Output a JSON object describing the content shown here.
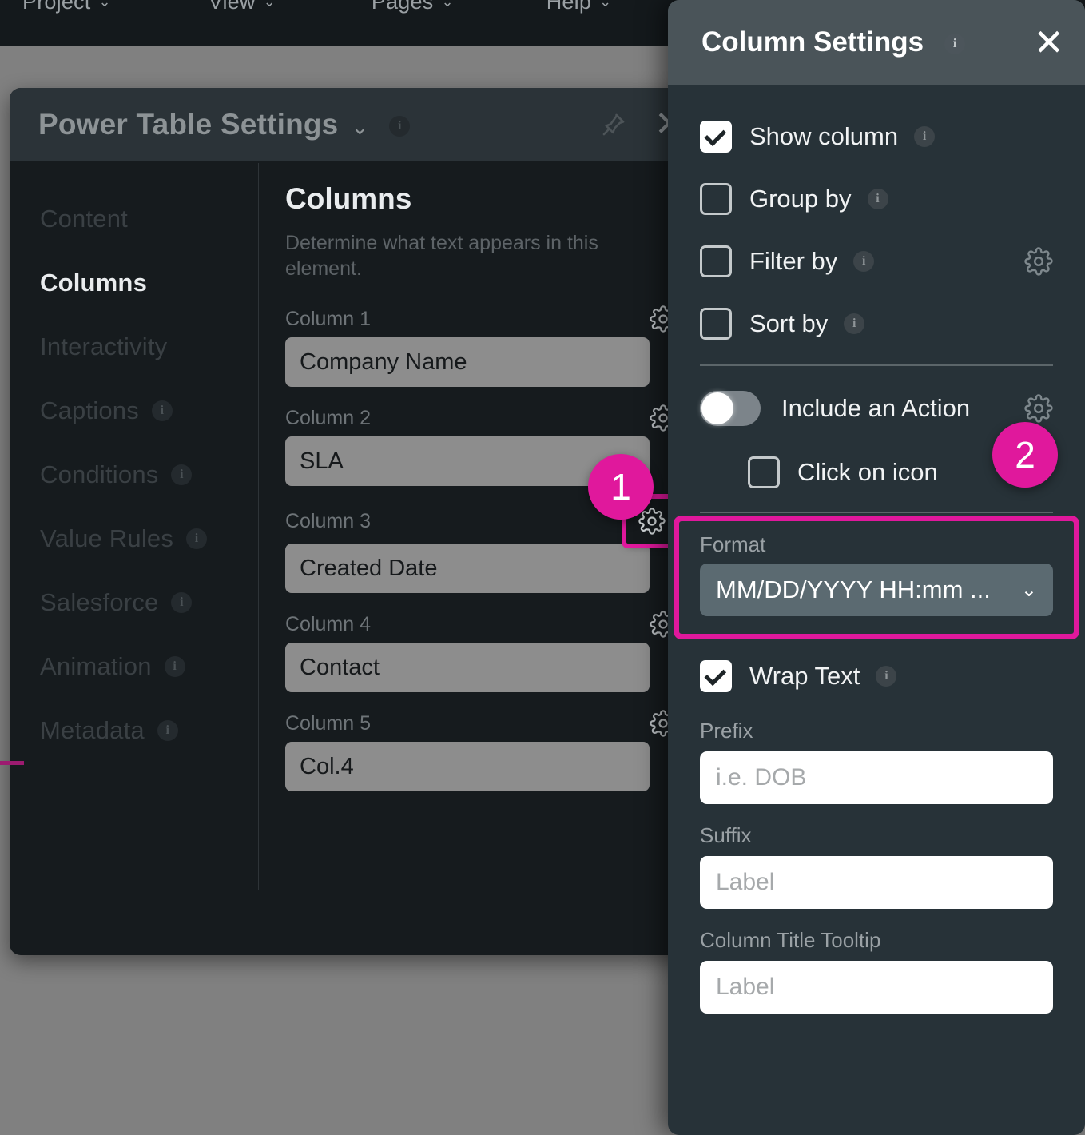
{
  "app": {
    "menu": [
      {
        "label": "Project",
        "caret": "chevron-down"
      },
      {
        "label": "View",
        "caret": "chevron-down"
      },
      {
        "label": "Pages",
        "caret": "chevron-down"
      },
      {
        "label": "Help",
        "caret": "chevron-down"
      }
    ]
  },
  "power_table_settings": {
    "title": "Power Table Settings",
    "title_caret": "⌄",
    "title_info": "i",
    "pin_icon": "pin-icon",
    "close_icon": "✕",
    "nav": [
      {
        "label": "Content",
        "active": false,
        "info": null
      },
      {
        "label": "Columns",
        "active": true,
        "info": null
      },
      {
        "label": "Interactivity",
        "active": false,
        "info": null
      },
      {
        "label": "Captions",
        "active": false,
        "info": "i"
      },
      {
        "label": "Conditions",
        "active": false,
        "info": "i"
      },
      {
        "label": "Value Rules",
        "active": false,
        "info": "i"
      },
      {
        "label": "Salesforce",
        "active": false,
        "info": "i"
      },
      {
        "label": "Animation",
        "active": false,
        "info": "i"
      },
      {
        "label": "Metadata",
        "active": false,
        "info": "i"
      }
    ],
    "content": {
      "heading": "Columns",
      "description": "Determine what text appears in this element.",
      "columns": [
        {
          "label": "Column 1",
          "value": "Company Name",
          "gear": "gear-icon",
          "highlighted": false
        },
        {
          "label": "Column 2",
          "value": "SLA",
          "gear": "gear-icon",
          "highlighted": false
        },
        {
          "label": "Column 3",
          "value": "Created Date",
          "gear": "gear-icon",
          "highlighted": true
        },
        {
          "label": "Column 4",
          "value": "Contact",
          "gear": "gear-icon",
          "highlighted": false
        },
        {
          "label": "Column 5",
          "value": "Col.4",
          "gear": "gear-icon",
          "highlighted": false
        }
      ]
    }
  },
  "column_settings": {
    "title": "Column Settings",
    "title_info": "i",
    "close_icon": "✕",
    "checkboxes": [
      {
        "label": "Show column",
        "checked": true,
        "info": "i",
        "gear": false
      },
      {
        "label": "Group by",
        "checked": false,
        "info": "i",
        "gear": false
      },
      {
        "label": "Filter by",
        "checked": false,
        "info": "i",
        "gear": true
      },
      {
        "label": "Sort by",
        "checked": false,
        "info": "i",
        "gear": false
      }
    ],
    "action_toggle": {
      "label": "Include an Action",
      "on": true,
      "gear": "gear-icon"
    },
    "click_on_icon": {
      "label": "Click on icon",
      "checked": false
    },
    "format": {
      "label": "Format",
      "value": "MM/DD/YYYY HH:mm ...",
      "caret": "⌄"
    },
    "wrap_text": {
      "label": "Wrap Text",
      "checked": true,
      "info": "i"
    },
    "prefix": {
      "label": "Prefix",
      "value": "",
      "placeholder": "i.e. DOB"
    },
    "suffix": {
      "label": "Suffix",
      "value": "",
      "placeholder": "Label"
    },
    "column_title_tooltip": {
      "label": "Column Title Tooltip",
      "value": "",
      "placeholder": "Label"
    }
  },
  "annotations": {
    "badge_1": "1",
    "badge_2": "2",
    "highlight_color": "#e0189c"
  }
}
